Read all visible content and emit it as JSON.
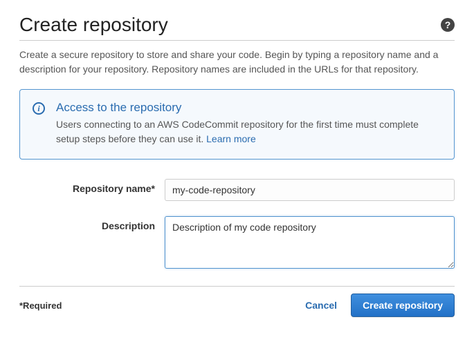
{
  "header": {
    "title": "Create repository"
  },
  "description": "Create a secure repository to store and share your code. Begin by typing a repository name and a description for your repository. Repository names are included in the URLs for that repository.",
  "info": {
    "title": "Access to the repository",
    "body": "Users connecting to an AWS CodeCommit repository for the first time must complete setup steps before they can use it. ",
    "learn_more": "Learn more"
  },
  "form": {
    "repository_name": {
      "label": "Repository name*",
      "value": "my-code-repository"
    },
    "description_field": {
      "label": "Description",
      "value": "Description of my code repository"
    }
  },
  "footer": {
    "required_note": "*Required",
    "cancel_label": "Cancel",
    "submit_label": "Create repository"
  }
}
